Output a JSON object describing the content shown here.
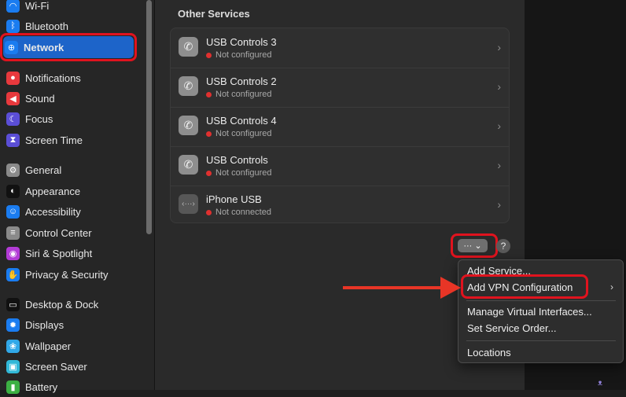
{
  "sidebar": {
    "items": [
      {
        "label": "Wi-Fi",
        "icon": "wifi-icon",
        "color": "#1a7cf0"
      },
      {
        "label": "Bluetooth",
        "icon": "bluetooth-icon",
        "color": "#1a7cf0"
      },
      {
        "label": "Network",
        "icon": "globe-icon",
        "color": "#1a7cf0"
      },
      {
        "label": "Notifications",
        "icon": "bell-icon",
        "color": "#e8393d"
      },
      {
        "label": "Sound",
        "icon": "speaker-icon",
        "color": "#e8393d"
      },
      {
        "label": "Focus",
        "icon": "moon-icon",
        "color": "#5b4ed6"
      },
      {
        "label": "Screen Time",
        "icon": "hourglass-icon",
        "color": "#5b4ed6"
      },
      {
        "label": "General",
        "icon": "gear-icon",
        "color": "#8a8a8a"
      },
      {
        "label": "Appearance",
        "icon": "appearance-icon",
        "color": "#111111"
      },
      {
        "label": "Accessibility",
        "icon": "accessibility-icon",
        "color": "#1a7cf0"
      },
      {
        "label": "Control Center",
        "icon": "control-center-icon",
        "color": "#8a8a8a"
      },
      {
        "label": "Siri & Spotlight",
        "icon": "siri-icon",
        "color": "#b33bd6"
      },
      {
        "label": "Privacy & Security",
        "icon": "hand-icon",
        "color": "#1a7cf0"
      },
      {
        "label": "Desktop & Dock",
        "icon": "dock-icon",
        "color": "#111111"
      },
      {
        "label": "Displays",
        "icon": "sun-icon",
        "color": "#1a7cf0"
      },
      {
        "label": "Wallpaper",
        "icon": "wallpaper-icon",
        "color": "#31a8e8"
      },
      {
        "label": "Screen Saver",
        "icon": "screensaver-icon",
        "color": "#31b8d8"
      },
      {
        "label": "Battery",
        "icon": "battery-icon",
        "color": "#3cb043"
      }
    ]
  },
  "main": {
    "section_title": "Other Services",
    "services": [
      {
        "name": "USB Controls 3",
        "status": "Not configured",
        "icon": "phone-icon"
      },
      {
        "name": "USB Controls 2",
        "status": "Not configured",
        "icon": "phone-icon"
      },
      {
        "name": "USB Controls 4",
        "status": "Not configured",
        "icon": "phone-icon"
      },
      {
        "name": "USB Controls",
        "status": "Not configured",
        "icon": "phone-icon"
      },
      {
        "name": "iPhone USB",
        "status": "Not connected",
        "icon": "iphone-usb-icon"
      }
    ],
    "more_button": "··· ⌄",
    "help_button": "?"
  },
  "menu": {
    "items": [
      "Add Service...",
      "Add VPN Configuration",
      "Manage Virtual Interfaces...",
      "Set Service Order...",
      "Locations"
    ],
    "submenu_indicator": "›"
  },
  "colors": {
    "selection": "#1d64c9",
    "annotation_red": "#e0131e",
    "status_dot": "#e0302f"
  }
}
